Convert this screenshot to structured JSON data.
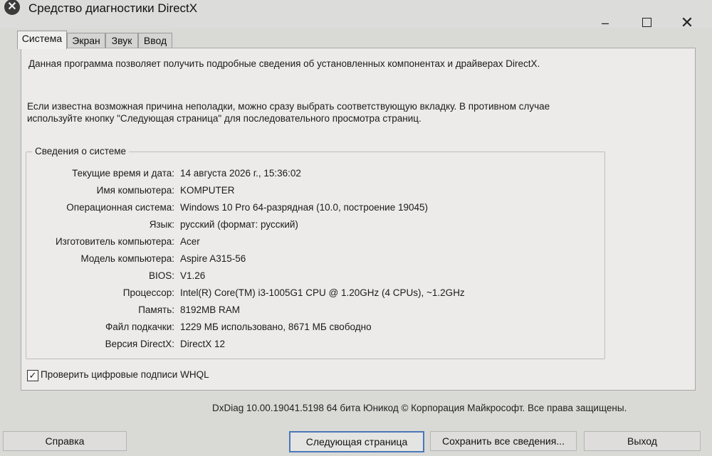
{
  "window": {
    "title": "Средство диагностики DirectX",
    "icon": "dxdiag-icon",
    "controls": {
      "minimize": "–",
      "close": "✕"
    }
  },
  "tabs": [
    {
      "label": "Система",
      "active": true
    },
    {
      "label": "Экран",
      "active": false
    },
    {
      "label": "Звук",
      "active": false
    },
    {
      "label": "Ввод",
      "active": false
    }
  ],
  "intro": {
    "line1": "Данная программа позволяет получить подробные сведения об установленных компонентах и драйверах DirectX.",
    "line2": "Если известна возможная причина неполадки, можно сразу выбрать соответствующую вкладку. В противном случае используйте кнопку \"Следующая страница\" для последовательного просмотра страниц."
  },
  "system_info": {
    "title": "Сведения о системе",
    "rows": [
      {
        "label": "Текущие время и дата:",
        "value": "14 августа 2026 г., 15:36:02"
      },
      {
        "label": "Имя компьютера:",
        "value": "KOMPUTER"
      },
      {
        "label": "Операционная система:",
        "value": "Windows 10 Pro 64-разрядная (10.0, построение 19045)"
      },
      {
        "label": "Язык:",
        "value": "русский (формат: русский)"
      },
      {
        "label": "Изготовитель компьютера:",
        "value": "Acer"
      },
      {
        "label": "Модель компьютера:",
        "value": "Aspire A315-56"
      },
      {
        "label": "BIOS:",
        "value": "V1.26"
      },
      {
        "label": "Процессор:",
        "value": "Intel(R) Core(TM) i3-1005G1 CPU @ 1.20GHz (4 CPUs), ~1.2GHz"
      },
      {
        "label": "Память:",
        "value": "8192MB RAM"
      },
      {
        "label": "Файл подкачки:",
        "value": "1229 МБ использовано, 8671 МБ свободно"
      },
      {
        "label": "Версия DirectX:",
        "value": "DirectX 12"
      }
    ]
  },
  "whql": {
    "label": "Проверить цифровые подписи WHQL",
    "checked": true,
    "mark": "✓"
  },
  "copyright": "DxDiag 10.00.19041.5198 64 бита Юникод © Корпорация Майкрософт. Все права защищены.",
  "buttons": {
    "help": "Справка",
    "next": "Следующая страница",
    "save": "Сохранить все сведения...",
    "exit": "Выход"
  }
}
